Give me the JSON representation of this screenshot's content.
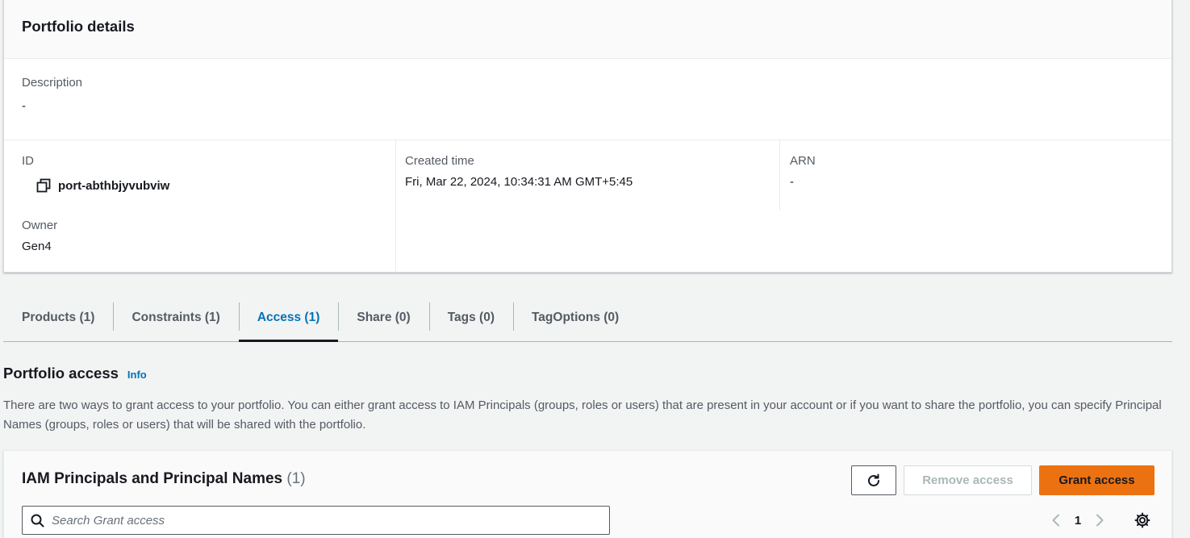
{
  "details": {
    "title": "Portfolio details",
    "description_label": "Description",
    "description_value": "-",
    "id_label": "ID",
    "id_value": "port-abthbjyvubviw",
    "owner_label": "Owner",
    "owner_value": "Gen4",
    "created_label": "Created time",
    "created_value": "Fri, Mar 22, 2024, 10:34:31 AM GMT+5:45",
    "arn_label": "ARN",
    "arn_value": "-"
  },
  "tabs": [
    {
      "label": "Products (1)"
    },
    {
      "label": "Constraints (1)"
    },
    {
      "label": "Access (1)",
      "active": true
    },
    {
      "label": "Share (0)"
    },
    {
      "label": "Tags (0)"
    },
    {
      "label": "TagOptions (0)"
    }
  ],
  "access": {
    "title": "Portfolio access",
    "info_link": "Info",
    "description": "There are two ways to grant access to your portfolio. You can either grant access to IAM Principals (groups, roles or users) that are present in your account or if you want to share the portfolio, you can specify Principal Names (groups, roles or users) that will be shared with the portfolio."
  },
  "table": {
    "title": "IAM Principals and Principal Names",
    "count": "(1)",
    "refresh_icon": "refresh-icon",
    "remove_label": "Remove access",
    "grant_label": "Grant access",
    "search_placeholder": "Search Grant access",
    "current_page": "1"
  },
  "colors": {
    "accent": "#0073bb",
    "primary_button": "#ec7211",
    "background": "#f2f3f3"
  }
}
